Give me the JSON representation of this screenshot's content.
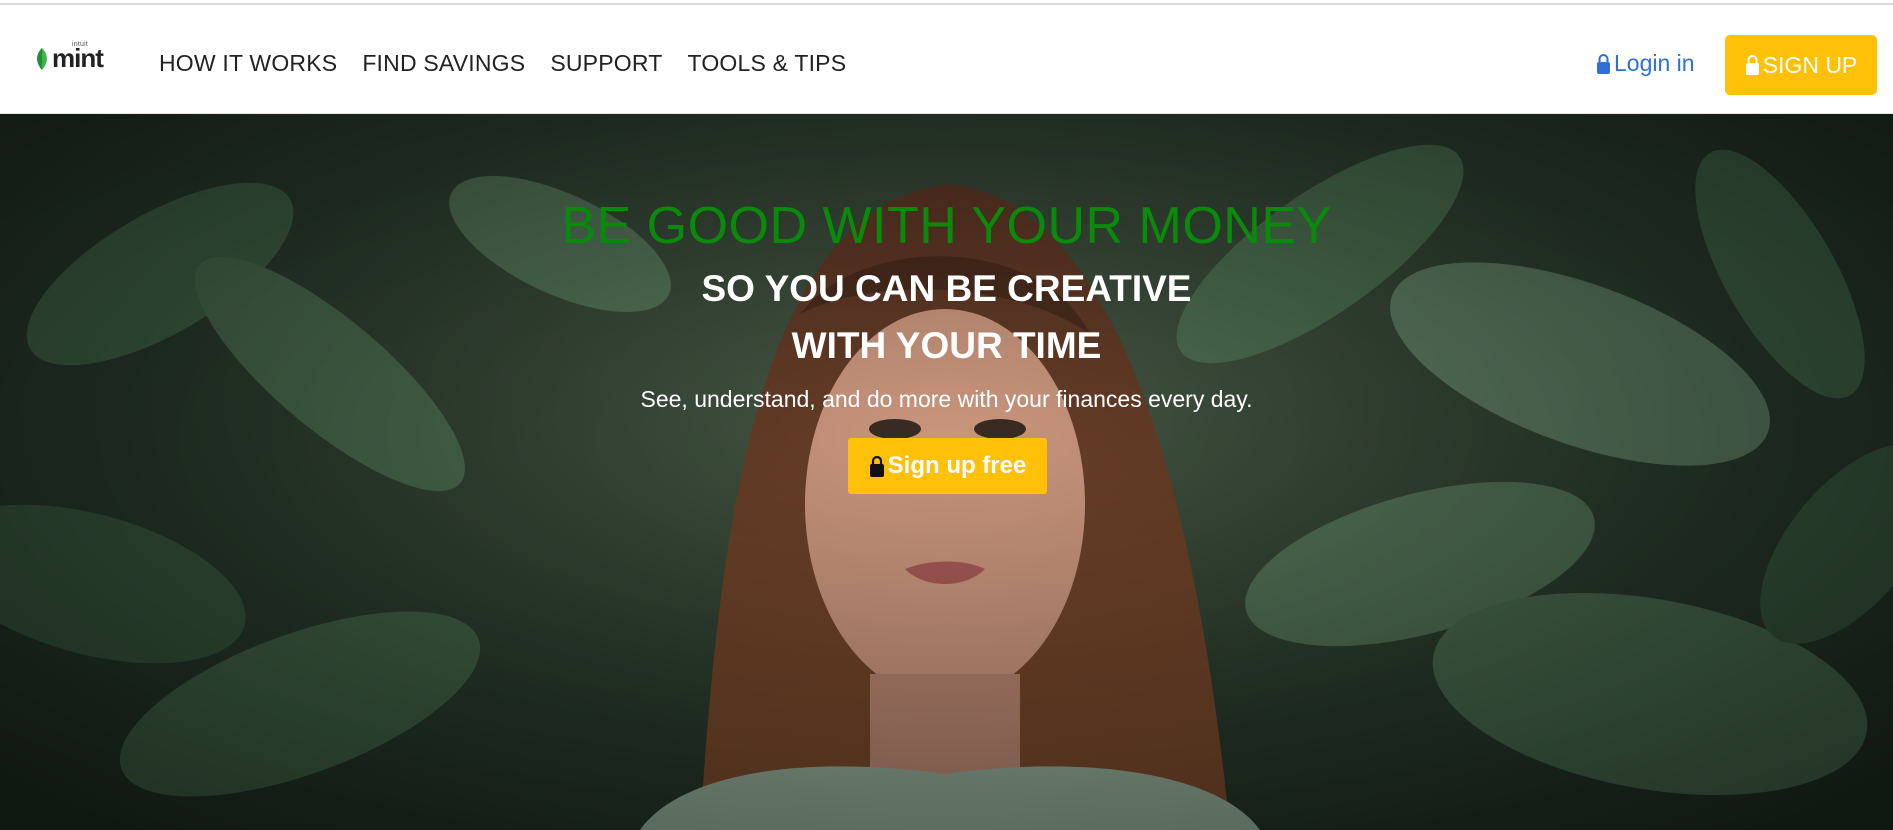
{
  "brand": {
    "name": "mint",
    "sub": "intuit"
  },
  "nav": {
    "links": [
      "HOW IT WORKS",
      "FIND SAVINGS",
      "SUPPORT",
      "TOOLS & TIPS"
    ],
    "login_label": "Login in",
    "signup_label": "SIGN UP"
  },
  "hero": {
    "headline": "BE GOOD WITH YOUR MONEY",
    "subheadline_1": "SO YOU CAN BE CREATIVE",
    "subheadline_2": "WITH YOUR TIME",
    "tagline": "See, understand, and do more with your finances every day.",
    "cta_label": "Sign up free"
  },
  "colors": {
    "accent": "#ffc107",
    "link": "#2f6fd6",
    "headline_green": "#0a8a0a",
    "brand_green": "#3bb54a"
  },
  "icons": [
    "mint-leaf-icon",
    "lock-icon"
  ]
}
